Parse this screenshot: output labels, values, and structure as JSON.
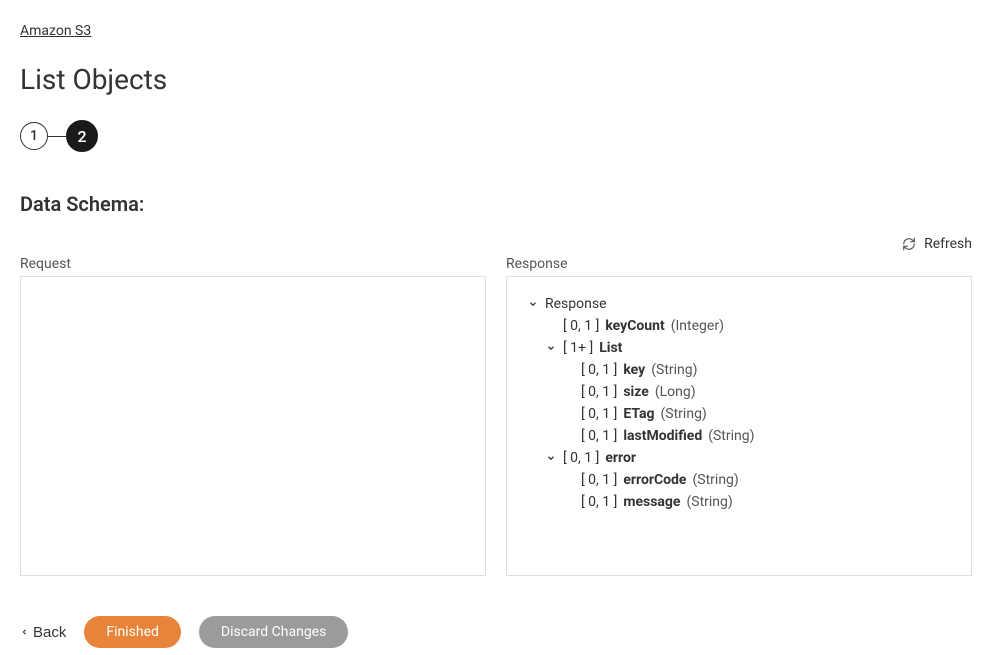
{
  "breadcrumb": {
    "service": "Amazon S3"
  },
  "page": {
    "title": "List Objects"
  },
  "stepper": {
    "step1": "1",
    "step2": "2"
  },
  "section": {
    "title": "Data Schema:"
  },
  "refresh": {
    "label": "Refresh"
  },
  "panels": {
    "request_label": "Request",
    "response_label": "Response"
  },
  "response_tree": {
    "root": {
      "name": "Response"
    },
    "keyCount": {
      "card": "[ 0, 1 ]",
      "name": "keyCount",
      "type": "(Integer)"
    },
    "list": {
      "card": "[ 1+ ]",
      "name": "List"
    },
    "key": {
      "card": "[ 0, 1 ]",
      "name": "key",
      "type": "(String)"
    },
    "size": {
      "card": "[ 0, 1 ]",
      "name": "size",
      "type": "(Long)"
    },
    "etag": {
      "card": "[ 0, 1 ]",
      "name": "ETag",
      "type": "(String)"
    },
    "lastModified": {
      "card": "[ 0, 1 ]",
      "name": "lastModified",
      "type": "(String)"
    },
    "error": {
      "card": "[ 0, 1 ]",
      "name": "error"
    },
    "errorCode": {
      "card": "[ 0, 1 ]",
      "name": "errorCode",
      "type": "(String)"
    },
    "message": {
      "card": "[ 0, 1 ]",
      "name": "message",
      "type": "(String)"
    }
  },
  "buttons": {
    "back": "Back",
    "finished": "Finished",
    "discard": "Discard Changes"
  }
}
